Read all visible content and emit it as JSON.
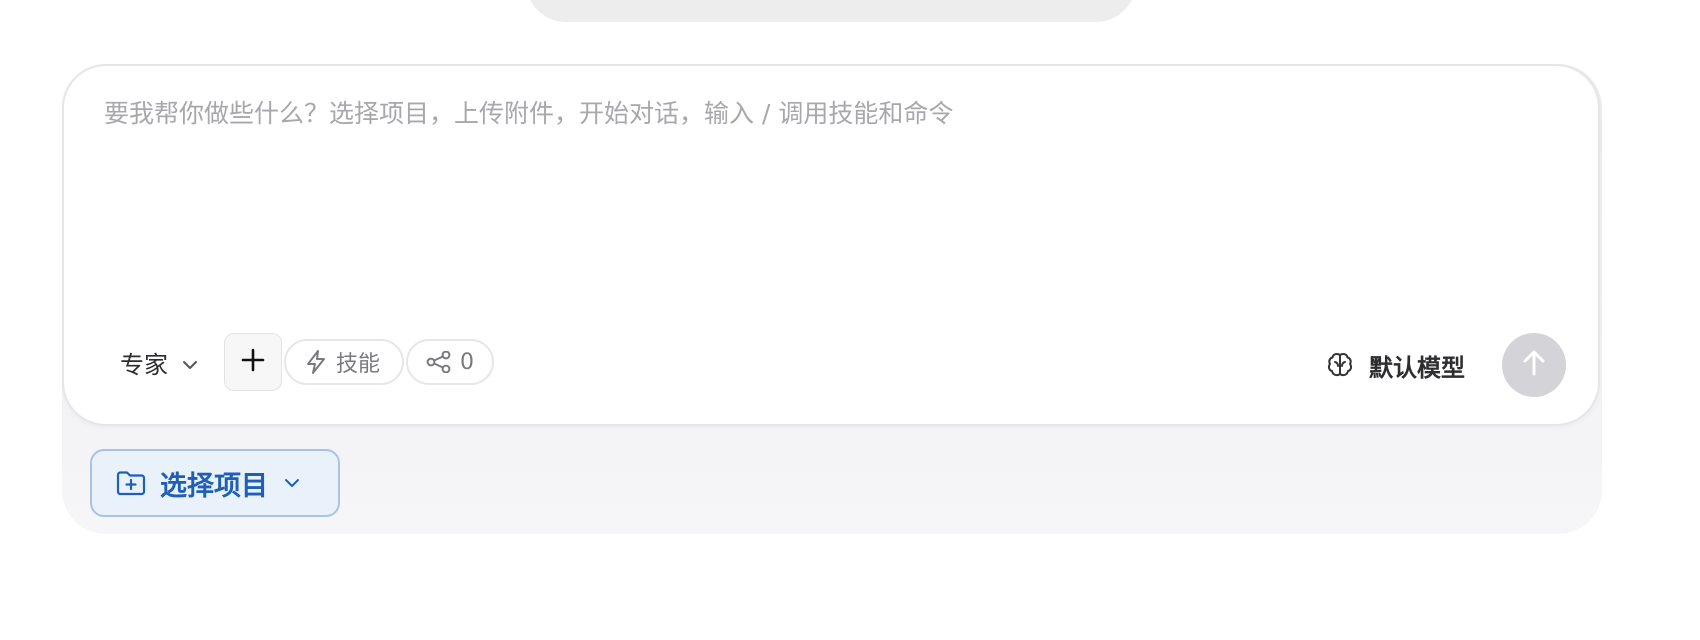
{
  "composer": {
    "placeholder": "要我帮你做些什么？选择项目，上传附件，开始对话，输入 / 调用技能和命令",
    "value": ""
  },
  "toolbar": {
    "mode_label": "专家",
    "skill_label": "技能",
    "share_count": "0",
    "model_label": "默认模型"
  },
  "project": {
    "label": "选择项目"
  },
  "icons": {
    "mode_chevron": "chevron-down-icon",
    "plus": "plus-icon",
    "skill": "lightning-icon",
    "share": "share-nodes-icon",
    "model": "brain-icon",
    "send": "arrow-up-icon",
    "folder": "folder-plus-icon",
    "project_chevron": "chevron-down-icon"
  },
  "colors": {
    "accent": "#1f5fb5",
    "send_disabled": "#d3d3d8",
    "project_bg": "#e9f1fb"
  }
}
